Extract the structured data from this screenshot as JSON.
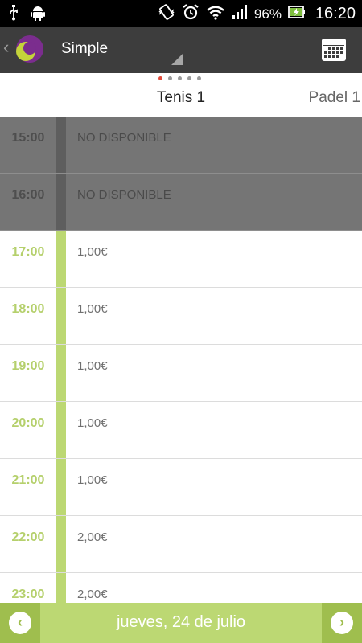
{
  "status_bar": {
    "battery_percent": "96%",
    "time": "16:20",
    "icons": [
      "usb-icon",
      "android-icon",
      "vibrate-icon",
      "alarm-icon",
      "wifi-icon",
      "signal-icon",
      "battery-charging-icon"
    ]
  },
  "action_bar": {
    "title": "Simple"
  },
  "pager": {
    "page_count": 5,
    "active_index": 0,
    "current_tab": "Tenis 1",
    "next_tab": "Padel 1"
  },
  "slots": [
    {
      "time": "15:00",
      "info": "NO DISPONIBLE",
      "available": false
    },
    {
      "time": "16:00",
      "info": "NO DISPONIBLE",
      "available": false
    },
    {
      "time": "17:00",
      "info": "1,00€",
      "available": true
    },
    {
      "time": "18:00",
      "info": "1,00€",
      "available": true
    },
    {
      "time": "19:00",
      "info": "1,00€",
      "available": true
    },
    {
      "time": "20:00",
      "info": "1,00€",
      "available": true
    },
    {
      "time": "21:00",
      "info": "1,00€",
      "available": true
    },
    {
      "time": "22:00",
      "info": "2,00€",
      "available": true
    },
    {
      "time": "23:00",
      "info": "2,00€",
      "available": true
    }
  ],
  "date_bar": {
    "date": "jueves, 24 de julio",
    "prev_symbol": "‹",
    "next_symbol": "›"
  },
  "colors": {
    "accent_green": "#bcd873",
    "nav_green": "#9fbe4e",
    "unavailable_gray": "#757575",
    "action_bar": "#3d3d3d",
    "active_dot": "#e24b3b"
  }
}
